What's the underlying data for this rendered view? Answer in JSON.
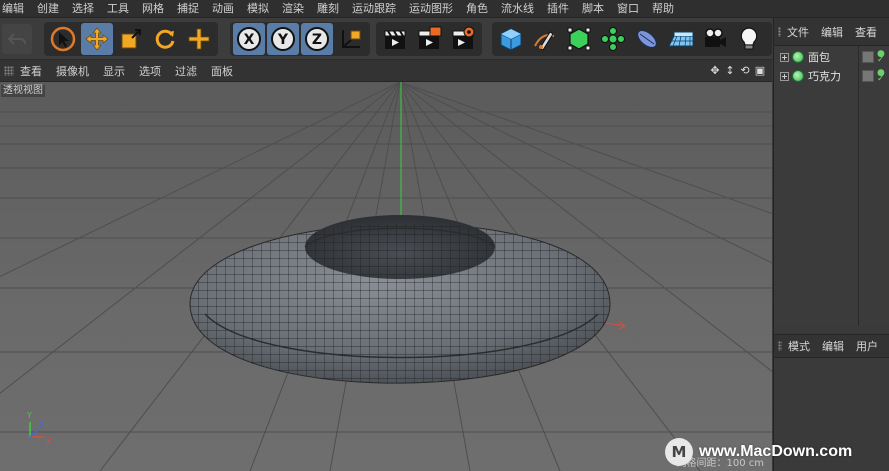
{
  "menu": [
    "编辑",
    "创建",
    "选择",
    "工具",
    "网格",
    "捕捉",
    "动画",
    "模拟",
    "渲染",
    "雕刻",
    "运动跟踪",
    "运动图形",
    "角色",
    "流水线",
    "插件",
    "脚本",
    "窗口",
    "帮助"
  ],
  "viewport_menu": [
    "查看",
    "摄像机",
    "显示",
    "选项",
    "过滤",
    "面板"
  ],
  "viewport": {
    "label": "透视视图",
    "grid_spacing": "网格间距：100 cm",
    "axis_labels": {
      "y": "Y",
      "z": "Z",
      "x": "X"
    }
  },
  "toolbar": {
    "axis_buttons": [
      "X",
      "Y",
      "Z"
    ]
  },
  "objects_panel": {
    "tabs": [
      "文件",
      "编辑",
      "查看"
    ],
    "objects": [
      {
        "name": "面包"
      },
      {
        "name": "巧克力"
      }
    ]
  },
  "attributes_panel": {
    "tabs": [
      "模式",
      "编辑",
      "用户"
    ]
  },
  "watermark": {
    "logo": "M",
    "text": "www.MacDown.com"
  },
  "colors": {
    "accent_active": "#5a7da8",
    "object_icon": "#2fb34a",
    "axis_y": "#3ad13a",
    "axis_x": "#e04a3a",
    "axis_z": "#3a6ae0"
  }
}
